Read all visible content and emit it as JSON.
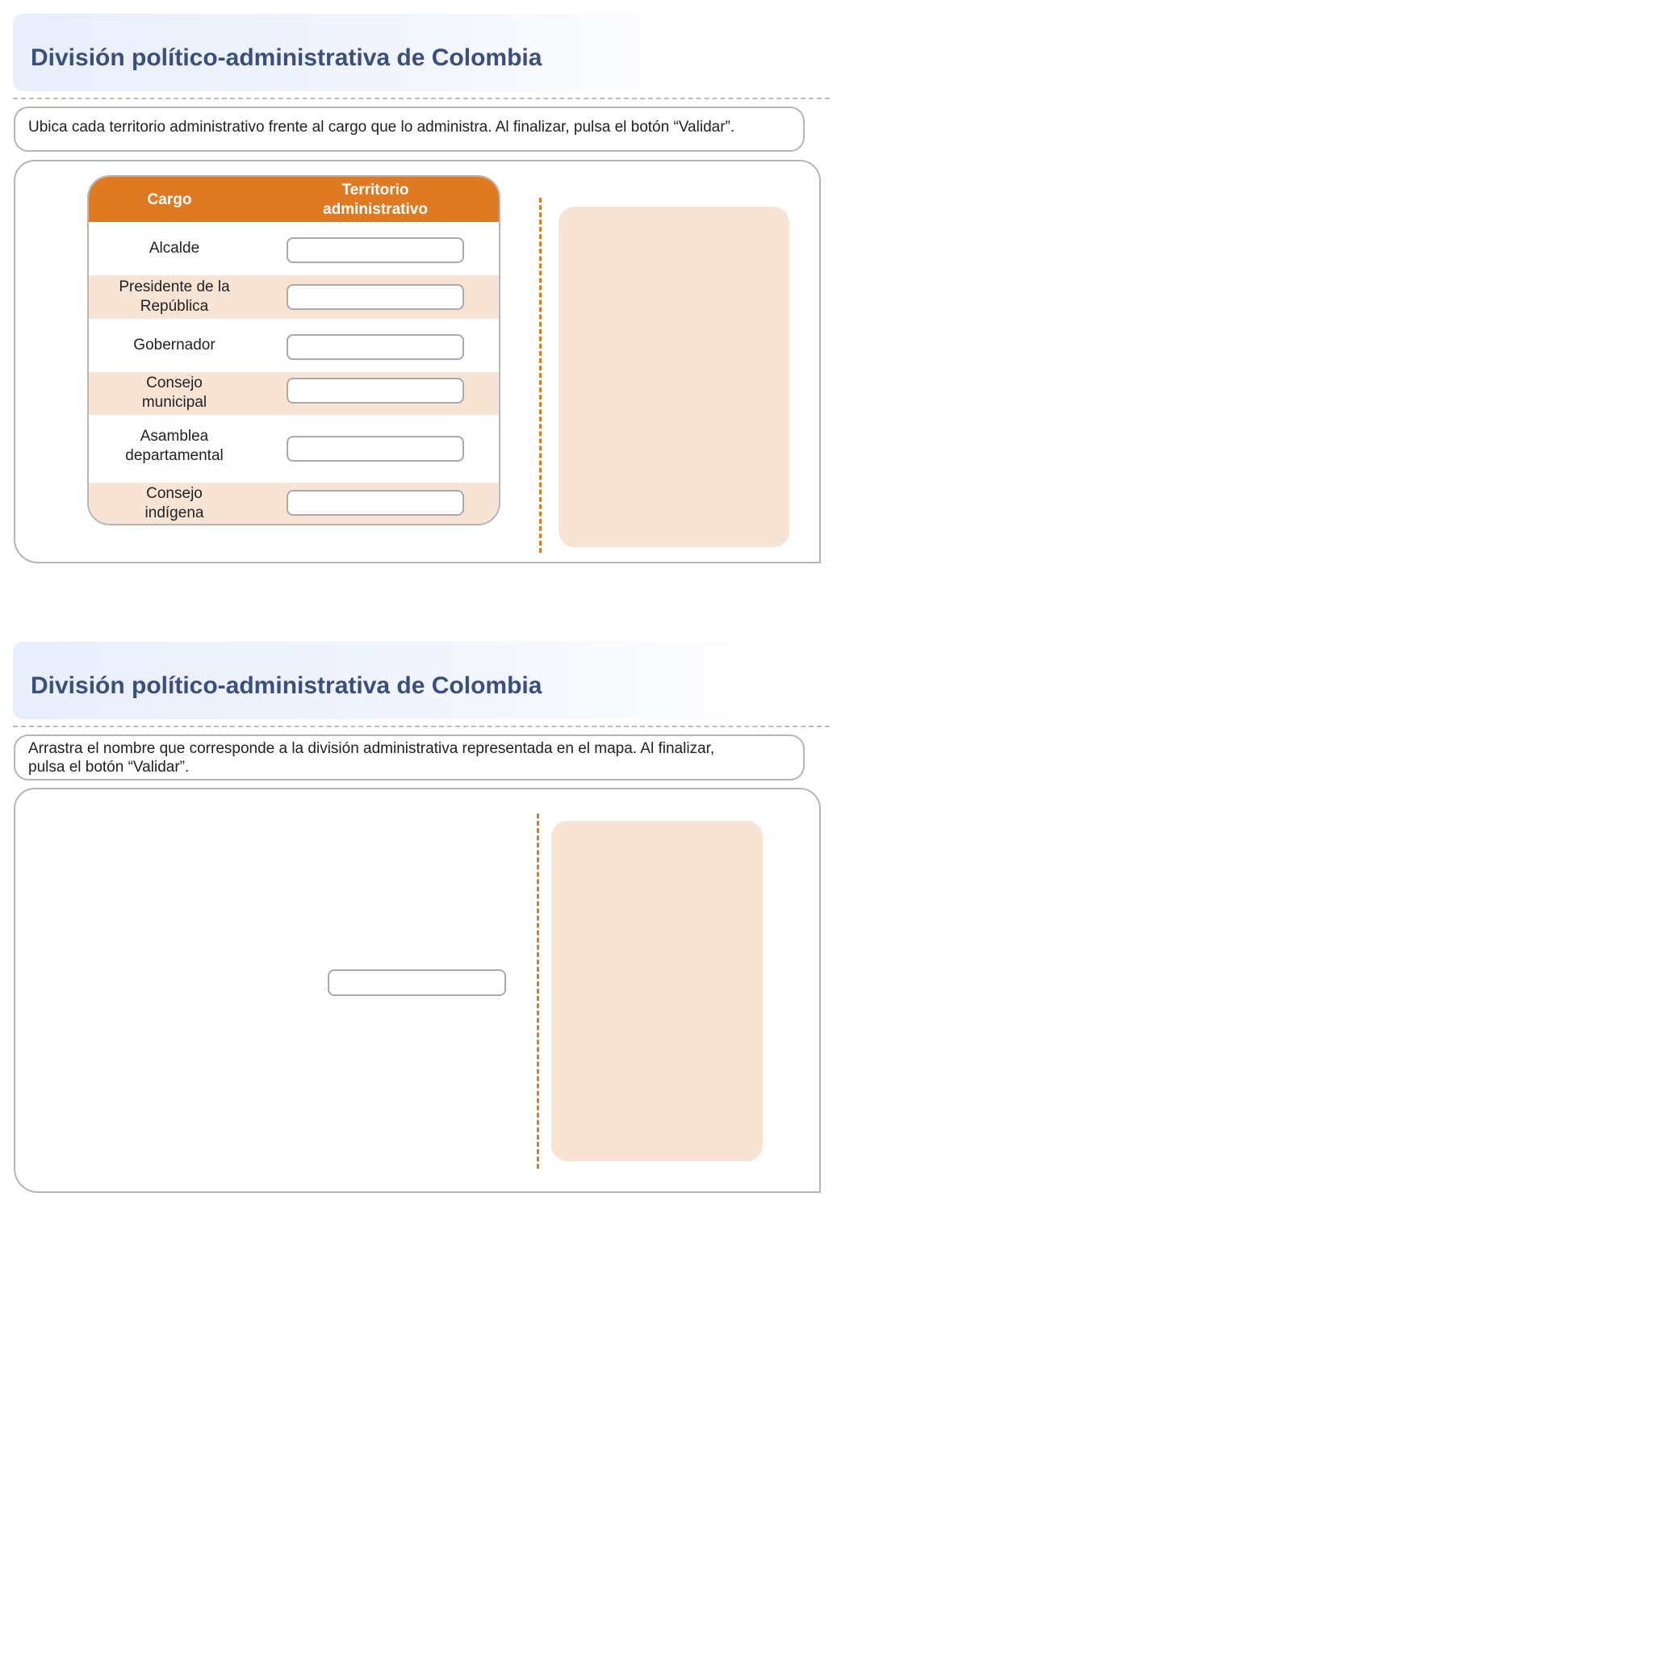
{
  "activity1": {
    "title": "División político-administrativa de Colombia",
    "instruction": "Ubica cada territorio administrativo frente al cargo que lo administra. Al finalizar, pulsa el botón “Validar”.",
    "table": {
      "headers": {
        "cargo": "Cargo",
        "territorio_line1": "Territorio",
        "territorio_line2": "administrativo"
      },
      "rows": [
        {
          "line1": "Alcalde",
          "line2": ""
        },
        {
          "line1": "Presidente de la",
          "line2": "República"
        },
        {
          "line1": "Gobernador",
          "line2": ""
        },
        {
          "line1": "Consejo",
          "line2": "municipal"
        },
        {
          "line1": "Asamblea",
          "line2": "departamental"
        },
        {
          "line1": "Consejo",
          "line2": "indígena"
        }
      ]
    }
  },
  "activity2": {
    "title": "División político-administrativa de Colombia",
    "instruction_line1": "Arrastra el nombre que corresponde a la división administrativa representada en el mapa. Al finalizar,",
    "instruction_line2": "pulsa el botón “Validar”."
  },
  "colors": {
    "accent": "#e07a22",
    "title_blue": "#3a4f80",
    "dropzone_fill": "#f8e4d5",
    "border_gray": "#b5b5b5"
  }
}
